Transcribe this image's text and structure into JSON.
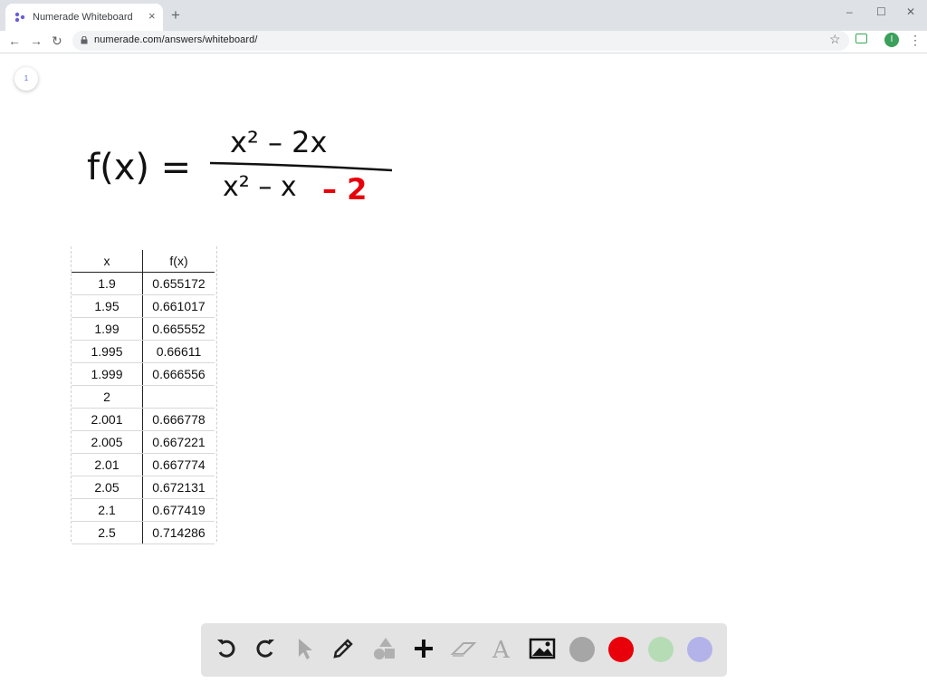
{
  "browser": {
    "tab_title": "Numerade Whiteboard",
    "tab_close": "×",
    "new_tab": "+",
    "url": "numerade.com/answers/whiteboard/",
    "profile_initial": "I",
    "window_controls": {
      "minimize": "–",
      "maximize": "☐",
      "close": "✕"
    },
    "nav": {
      "back": "←",
      "forward": "→",
      "reload": "↻"
    },
    "star": "☆",
    "menu": "⋮"
  },
  "whiteboard": {
    "page_number": "1",
    "formula": {
      "lhs": "f(x) =",
      "numerator": "x² – 2x",
      "denominator_main": "x² – x",
      "denominator_red": "– 2"
    },
    "table": {
      "headers": [
        "x",
        "f(x)"
      ],
      "rows": [
        [
          "1.9",
          "0.655172"
        ],
        [
          "1.95",
          "0.661017"
        ],
        [
          "1.99",
          "0.665552"
        ],
        [
          "1.995",
          "0.66611"
        ],
        [
          "1.999",
          "0.666556"
        ],
        [
          "2",
          ""
        ],
        [
          "2.001",
          "0.666778"
        ],
        [
          "2.005",
          "0.667221"
        ],
        [
          "2.01",
          "0.667774"
        ],
        [
          "2.05",
          "0.672131"
        ],
        [
          "2.1",
          "0.677419"
        ],
        [
          "2.5",
          "0.714286"
        ]
      ]
    }
  },
  "toolbar": {
    "tools": [
      "undo-icon",
      "redo-icon",
      "pointer-icon",
      "pen-icon",
      "shapes-icon",
      "add-icon",
      "eraser-icon",
      "text-icon",
      "image-icon"
    ],
    "colors": [
      "#a6a6a6",
      "#e8000b",
      "#b6dcb6",
      "#b3b3ea"
    ]
  }
}
